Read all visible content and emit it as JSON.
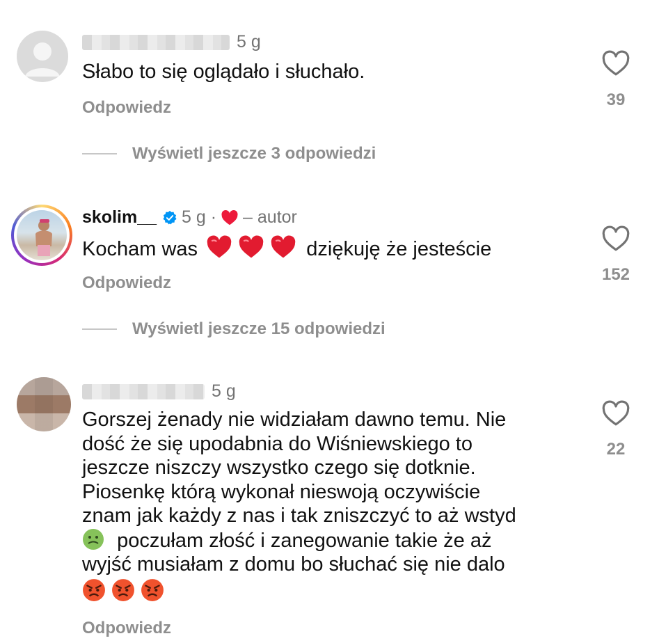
{
  "comments": [
    {
      "username": "",
      "time": "5 g",
      "text": "Słabo to się oglądało i słuchało.",
      "reply": "Odpowiedz",
      "likes": "39",
      "view_replies": "Wyświetl jeszcze 3 odpowiedzi"
    },
    {
      "username": "skolim__",
      "verified": true,
      "time": "5 g ·",
      "author_label": "– autor",
      "text_before": "Kocham was",
      "text_after": "dziękuję że jesteście",
      "reply": "Odpowiedz",
      "likes": "152",
      "view_replies": "Wyświetl jeszcze 15 odpowiedzi"
    },
    {
      "username": "",
      "time": "5 g",
      "text_lines": [
        "Gorszej żenady nie widziałam dawno temu. Nie",
        "dość że się upodabnia do Wiśniewskiego to",
        "jeszcze niszczy wszystko czego się dotknie.",
        "Piosenkę którą wykonał nieswoją oczywiście",
        "znam jak każdy z nas i tak zniszczyć to aż wstyd"
      ],
      "text_line6": "poczułam złość i zanegowanie takie że aż",
      "text_line7": "wyjść musiałam z domu bo słuchać się nie dalo",
      "reply": "Odpowiedz",
      "likes": "22"
    }
  ],
  "colors": {
    "heart_red": "#ed1a3b",
    "muted": "#8e8e8e",
    "verified_blue": "#0095f6"
  }
}
